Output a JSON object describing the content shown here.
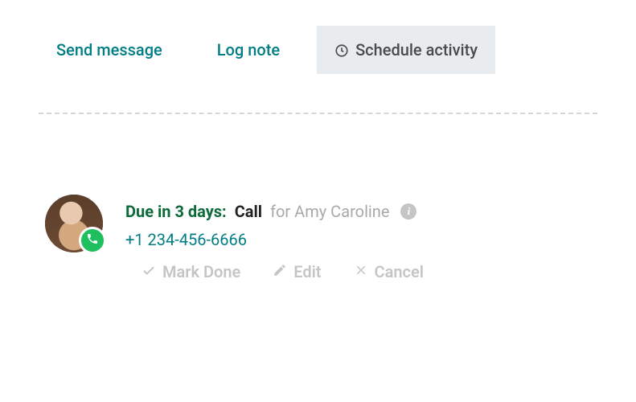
{
  "tabs": {
    "send_message": "Send message",
    "log_note": "Log note",
    "schedule_activity": "Schedule activity"
  },
  "activity": {
    "due_label": "Due in 3 days:",
    "type": "Call",
    "person_prefix": "for",
    "person_name": "Amy Caroline",
    "phone": "+1 234-456-6666"
  },
  "actions": {
    "mark_done": "Mark Done",
    "edit": "Edit",
    "cancel": "Cancel"
  }
}
